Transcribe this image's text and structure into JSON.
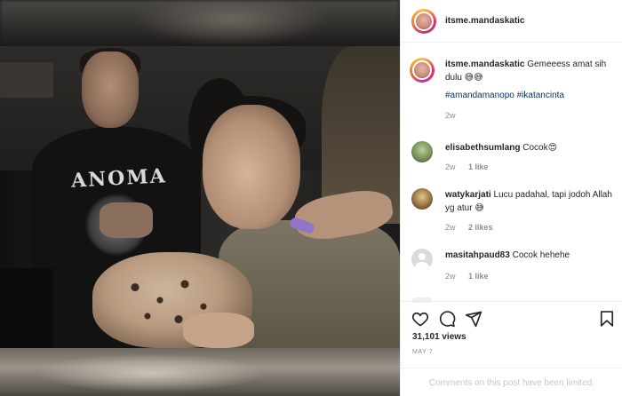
{
  "post": {
    "username": "itsme.mandaskatic",
    "caption_user": "itsme.mandaskatic",
    "caption_text": "Gemeeess amat sih dulu 😅😅",
    "hashtags": "#amandamanopo #ikatancinta",
    "caption_time": "2w"
  },
  "video": {
    "shirt_text": "ANOMA"
  },
  "comments": [
    {
      "user": "elisabethsumlang",
      "text": "Cocok😍",
      "time": "2w",
      "likes": "1 like"
    },
    {
      "user": "watykarjati",
      "text": "Lucu padahal, tapi jodoh Allah yg atur 😅",
      "time": "2w",
      "likes": "2 likes"
    },
    {
      "user": "masitahpaud83",
      "text": "Cocok hehehe",
      "time": "2w",
      "likes": "1 like"
    }
  ],
  "stats": {
    "views": "31,101 views",
    "date": "MAY 7"
  },
  "footer": {
    "limited_text": "Comments on this post have been limited."
  },
  "icons": [
    "heart-icon",
    "comment-icon",
    "share-icon",
    "bookmark-icon"
  ]
}
